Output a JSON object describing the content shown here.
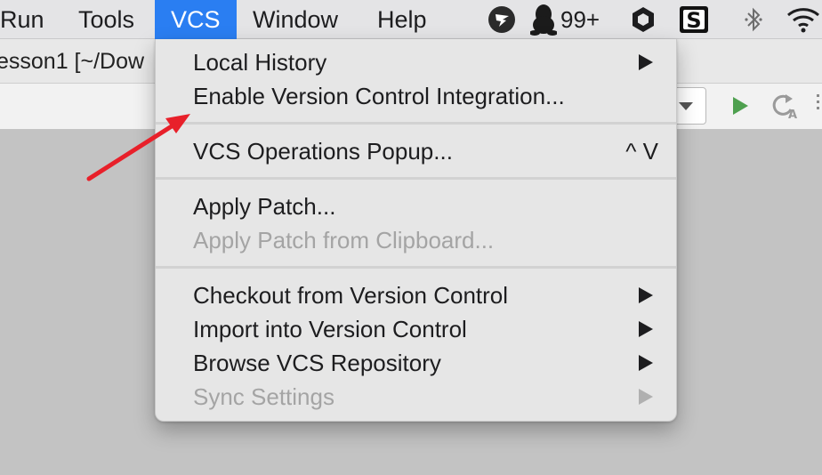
{
  "menubar": {
    "items": [
      {
        "label": "Run"
      },
      {
        "label": "Tools"
      },
      {
        "label": "VCS",
        "active": true
      },
      {
        "label": "Window"
      },
      {
        "label": "Help"
      }
    ],
    "status": {
      "qq_badge": "99+",
      "icons": [
        "dingtalk-icon",
        "qq-penguin-icon",
        "hexagon-app-icon",
        "s-app-icon",
        "bluetooth-icon",
        "wifi-icon"
      ]
    },
    "active_color": "#2a7ef2"
  },
  "window": {
    "title": "esson1 [~/Dow"
  },
  "vcs_menu": {
    "items": [
      {
        "label": "Local History",
        "submenu": true,
        "enabled": true
      },
      {
        "label": "Enable Version Control Integration...",
        "submenu": false,
        "enabled": true
      },
      {
        "label": "VCS Operations Popup...",
        "shortcut": "^ V",
        "enabled": true
      },
      {
        "label": "Apply Patch...",
        "enabled": true
      },
      {
        "label": "Apply Patch from Clipboard...",
        "enabled": false
      },
      {
        "label": "Checkout from Version Control",
        "submenu": true,
        "enabled": true
      },
      {
        "label": "Import into Version Control",
        "submenu": true,
        "enabled": true
      },
      {
        "label": "Browse VCS Repository",
        "submenu": true,
        "enabled": true
      },
      {
        "label": "Sync Settings",
        "submenu": true,
        "enabled": false
      }
    ]
  },
  "annotation": {
    "color": "#e8202a",
    "points_to": "Enable Version Control Integration..."
  }
}
